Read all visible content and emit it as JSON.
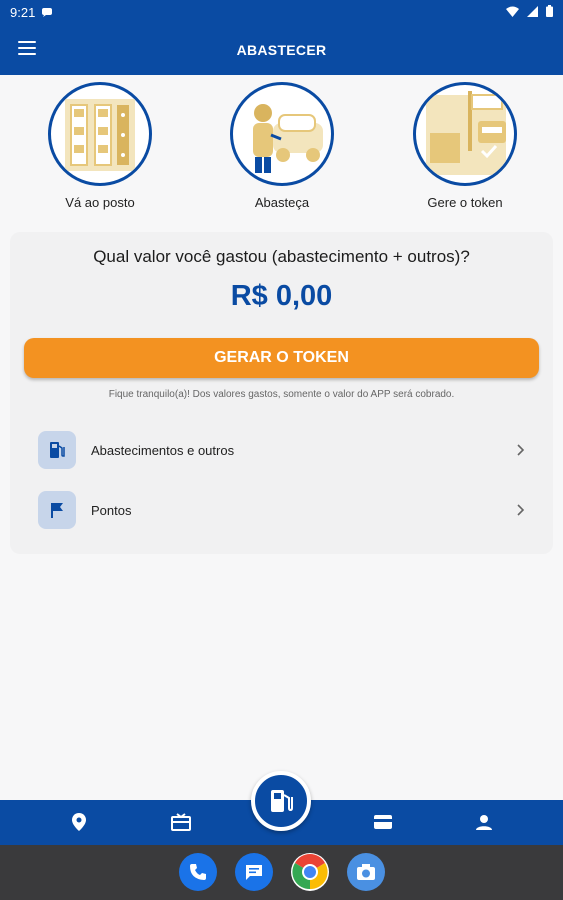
{
  "status": {
    "time": "9:21"
  },
  "appbar": {
    "title": "ABASTECER",
    "menu_icon": "hamburger-icon"
  },
  "steps": [
    {
      "label": "Vá ao posto",
      "icon": "gas-station-illustration"
    },
    {
      "label": "Abasteça",
      "icon": "refueling-illustration"
    },
    {
      "label": "Gere o token",
      "icon": "token-illustration"
    }
  ],
  "card": {
    "question": "Qual valor você gastou (abastecimento + outros)?",
    "amount": "R$ 0,00",
    "button_label": "GERAR O TOKEN",
    "note": "Fique tranquilo(a)! Dos valores gastos, somente o valor do APP será cobrado.",
    "items": [
      {
        "label": "Abastecimentos e outros",
        "icon": "fuel-pump-icon"
      },
      {
        "label": "Pontos",
        "icon": "flag-icon"
      }
    ]
  },
  "bottom_nav": [
    "location-pin-icon",
    "gift-card-icon",
    "fuel-pump-icon",
    "wallet-icon",
    "profile-icon"
  ],
  "dock": [
    "phone-icon",
    "messages-icon",
    "chrome-icon",
    "camera-icon"
  ],
  "colors": {
    "primary": "#0a4ba3",
    "accent": "#f39221",
    "illustration": "#e6c77a"
  }
}
